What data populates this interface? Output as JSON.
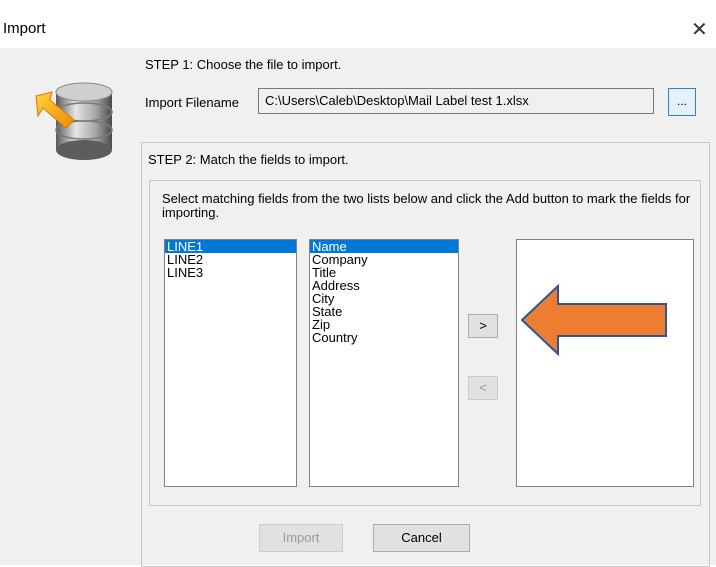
{
  "window": {
    "title": "Import",
    "close_glyph": "✕",
    "close_icon": "close-icon"
  },
  "step1": {
    "label": "STEP 1:  Choose the file to import."
  },
  "filename": {
    "label": "Import Filename",
    "value": "C:\\Users\\Caleb\\Desktop\\Mail Label test 1.xlsx",
    "browse_label": "..."
  },
  "step2": {
    "label": "STEP 2:  Match the fields to import.",
    "instructions": "Select matching fields from the two lists below and click the Add button to mark the fields for importing."
  },
  "source_fields": {
    "items": [
      "LINE1",
      "LINE2",
      "LINE3"
    ],
    "selected": "LINE1"
  },
  "target_fields": {
    "items": [
      "Name",
      "Company",
      "Title",
      "Address",
      "City",
      "State",
      "Zip",
      "Country"
    ],
    "selected": "Name"
  },
  "mapped_fields": {
    "items": []
  },
  "buttons": {
    "add": ">",
    "remove": "<",
    "import": "Import",
    "cancel": "Cancel"
  },
  "annotation": {
    "icon": "pointer-arrow-icon",
    "fill": "#ed7d31",
    "stroke": "#2f5597"
  },
  "logo": {
    "icon": "database-import-icon"
  }
}
